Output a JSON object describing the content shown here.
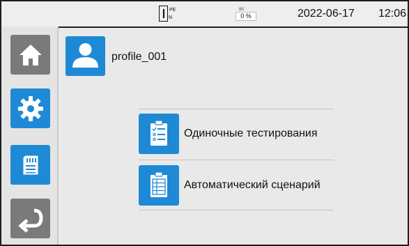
{
  "status_bar": {
    "pe_indicator": {
      "top_label": "PE",
      "bottom_label": "N"
    },
    "battery_percent": "0 %",
    "date": "2022-06-17",
    "time": "12:06"
  },
  "sidebar": {
    "items": [
      {
        "icon": "home-icon",
        "color": "#7a7a7a"
      },
      {
        "icon": "gear-icon",
        "color": "#1e8ad6"
      },
      {
        "icon": "sd-card-icon",
        "color": "#1e8ad6"
      },
      {
        "icon": "back-arrow-icon",
        "color": "#7a7a7a"
      }
    ]
  },
  "profile": {
    "icon": "user-icon",
    "name": "profile_001"
  },
  "menu": {
    "items": [
      {
        "icon": "checklist-clipboard-icon",
        "label": "Одиночные тестирования"
      },
      {
        "icon": "grid-clipboard-icon",
        "label": "Автоматический сценарий"
      }
    ]
  },
  "colors": {
    "accent": "#1e8ad6",
    "inactive": "#7a7a7a",
    "background": "#e9e9e9"
  }
}
